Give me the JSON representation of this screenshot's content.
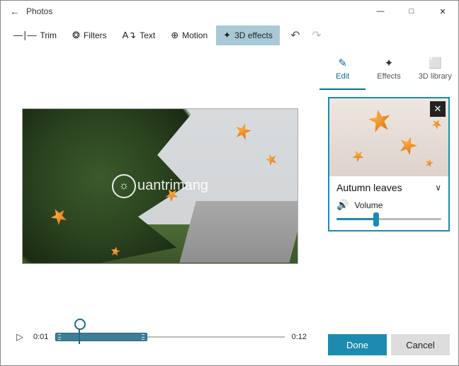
{
  "window": {
    "title": "Photos"
  },
  "toolbar": {
    "trim": "Trim",
    "filters": "Filters",
    "text": "Text",
    "motion": "Motion",
    "effects3d": "3D effects"
  },
  "side_tabs": {
    "edit": "Edit",
    "effects": "Effects",
    "library": "3D library"
  },
  "effect": {
    "name": "Autumn leaves",
    "volume_label": "Volume",
    "volume_percent": 38
  },
  "timeline": {
    "current": "0:01",
    "duration": "0:12"
  },
  "footer": {
    "done": "Done",
    "cancel": "Cancel"
  },
  "watermark": "uantrimang"
}
